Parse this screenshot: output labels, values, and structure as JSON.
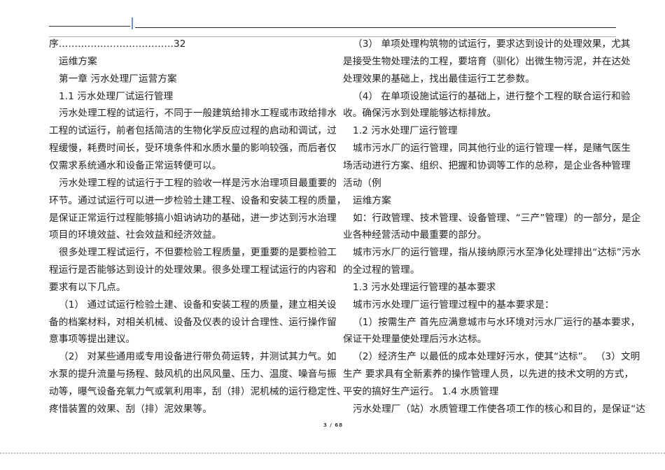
{
  "left_column": [
    {
      "text": "序………………………………32",
      "indent": false
    },
    {
      "text": "运维方案",
      "indent": true
    },
    {
      "text": "第一章  污水处理厂运营方案",
      "indent": true
    },
    {
      "text": "1.1 污水处理厂试运行管理",
      "indent": true
    },
    {
      "text": "污水处理工程的试运行，不同于一般建筑给排水工程或市政给排水",
      "indent": true
    },
    {
      "text": "工程的试运行，前者包括简洁的生物化学反应过程的启动和调试，过",
      "indent": false
    },
    {
      "text": "程缓慢，耗费时间长，受环境条件和水质水量的影响较强，而后者仅",
      "indent": false
    },
    {
      "text": "仅需求系统通水和设备正常运转便可以。",
      "indent": false
    },
    {
      "text": "污水处理工程的试运行于工程的验收一样是污水治理项目最重要的",
      "indent": true
    },
    {
      "text": "环节。通过试运行可以进一步检验土建工程、设备和安装工程的质量，",
      "indent": false
    },
    {
      "text": "是保证正常运行过程能够搞小姐讷讷功的基础，进一步达到污水治理",
      "indent": false
    },
    {
      "text": "项目的环境效益、社会效益和经济效益。",
      "indent": false
    },
    {
      "text": "很多处理工程试运行，不但要检验工程质量，更重要的是要检验工",
      "indent": true
    },
    {
      "text": "程运行是否能够达到设计的处理效果。很多处理工程试运行的内容和",
      "indent": false
    },
    {
      "text": "要求有以下几点。",
      "indent": false
    },
    {
      "text": "（1）  通过试运行检验土建、设备和安装工程的质量，建立相关设",
      "indent": true
    },
    {
      "text": "备的档案材料，对相关机械、设备及仪表的设计合理性、运行操作留",
      "indent": false
    },
    {
      "text": "意事项等提出建议。",
      "indent": false
    },
    {
      "text": "（2）  对某些通用或专用设备进行带负荷运转，并测试其力气。如",
      "indent": true
    },
    {
      "text": "水泵的提升流量与扬程、鼓风机的出风风量、压力、温度、噪音与振",
      "indent": false
    },
    {
      "text": "动等，曝气设备充氧力气或氧利用率，刮（排）泥机械的运行稳定性、",
      "indent": false
    },
    {
      "text": "疼惜装置的效果、刮（排）泥效果等。",
      "indent": false
    }
  ],
  "right_column": [
    {
      "text": "（3）  单项处理构筑物的试运行，要求达到设计的处理效果，尤其",
      "indent": true
    },
    {
      "text": "是接受生物处理法的工程，要培育（驯化）出微生物污泥，并在达处",
      "indent": false
    },
    {
      "text": "处理效果的基础上，找出最佳运行工艺参数。",
      "indent": false
    },
    {
      "text": "（4）  在单项设施试运行的基础上，进行整个工程的联合运行和验",
      "indent": true
    },
    {
      "text": "收。确保污水到处理能够达标排放。",
      "indent": false
    },
    {
      "text": "1.2 污水处理厂运行管理",
      "indent": true
    },
    {
      "text": "城市污水厂的运行管理，同其他行业的运行管理一样，是赌气医生",
      "indent": true
    },
    {
      "text": "场活动进行方案、组织、把握和协调等工作的总称，是企业各种管理",
      "indent": false
    },
    {
      "text": "活动（例",
      "indent": false
    },
    {
      "text": "运维方案",
      "indent": true
    },
    {
      "text": "如：行政管理、技术管理、设备管理、“三产”管理）的一部分，是企",
      "indent": true
    },
    {
      "text": "业各种经营活动中最重要的部分。",
      "indent": false
    },
    {
      "text": "城市污水厂的运行管理，指从接纳原污水至净化处理排出“达标”污水",
      "indent": true
    },
    {
      "text": "的全过程的管理。",
      "indent": false
    },
    {
      "text": "1.3 污水处理运行管理的基本要求",
      "indent": true
    },
    {
      "text": "城市污水处理厂运行管理过程中的基本要求是：",
      "indent": true
    },
    {
      "text": "（1）按需生产  首先应满意城市与水环境对污水厂运行的基本要求，",
      "indent": true
    },
    {
      "text": "保证干处理量使处理后污水达标。",
      "indent": false
    },
    {
      "text": "（2）经济生产  以最低的成本处理好污水，使其“达标”。  （3）文明",
      "indent": true
    },
    {
      "text": "生产  要求具有全新素养的操作管理人员，以先进的技术文明的方式，",
      "indent": false
    },
    {
      "text": "平安的搞好生产运行。  1.4 水质管理",
      "indent": false
    },
    {
      "text": "污水处理厂（站）水质管理工作使各项工作的核心和目的，是保证“达",
      "indent": true
    }
  ],
  "page_number": "3 / 68"
}
